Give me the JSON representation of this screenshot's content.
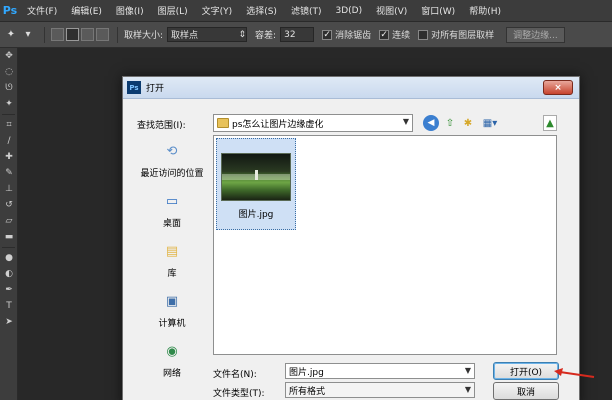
{
  "app": {
    "logo": "Ps",
    "menu": [
      "文件(F)",
      "编辑(E)",
      "图像(I)",
      "图层(L)",
      "文字(Y)",
      "选择(S)",
      "滤镜(T)",
      "3D(D)",
      "视图(V)",
      "窗口(W)",
      "帮助(H)"
    ]
  },
  "options": {
    "sample_size_label": "取样大小:",
    "sample_size_value": "取样点",
    "tolerance_label": "容差:",
    "tolerance_value": "32",
    "antialias_label": "消除锯齿",
    "antialias_checked": true,
    "contiguous_label": "连续",
    "contiguous_checked": true,
    "all_layers_label": "对所有图层取样",
    "all_layers_checked": false,
    "refine_edge_label": "调整边缘..."
  },
  "dialog": {
    "title": "打开",
    "app_icon": "Ps",
    "close_icon": "×",
    "look_in_label": "查找范围(I):",
    "look_in_value": "ps怎么让图片边缘虚化",
    "places": [
      {
        "label": "最近访问的位置",
        "icon": "recent-places-icon",
        "glyph": "⟲",
        "color": "#5b8ec9"
      },
      {
        "label": "桌面",
        "icon": "desktop-icon",
        "glyph": "▭",
        "color": "#2f6fc0"
      },
      {
        "label": "库",
        "icon": "libraries-icon",
        "glyph": "▤",
        "color": "#e2b64a"
      },
      {
        "label": "计算机",
        "icon": "computer-icon",
        "glyph": "▣",
        "color": "#3e6ea8"
      },
      {
        "label": "网络",
        "icon": "network-icon",
        "glyph": "◉",
        "color": "#2f8a4a"
      }
    ],
    "files": [
      {
        "name": "图片.jpg",
        "selected": true
      }
    ],
    "file_name_label": "文件名(N):",
    "file_name_value": "图片.jpg",
    "file_type_label": "文件类型(T):",
    "file_type_value": "所有格式",
    "open_label": "打开(O)",
    "cancel_label": "取消"
  }
}
